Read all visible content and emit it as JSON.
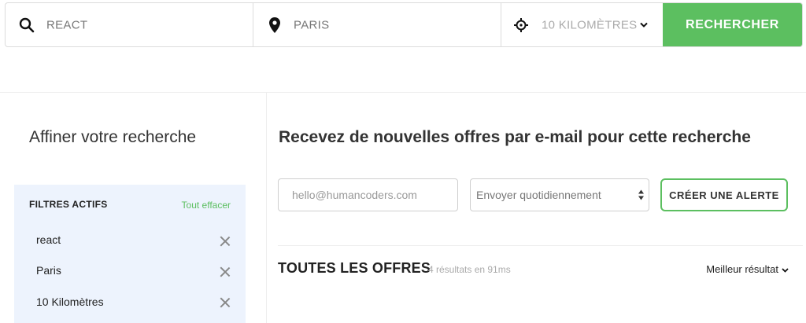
{
  "search": {
    "keyword": "REACT",
    "location": "PARIS",
    "radius": "10 KILOMÈTRES",
    "submit_label": "RECHERCHER",
    "icons": {
      "keyword": "search-icon",
      "location": "map-pin-icon",
      "radius": "crosshair-icon",
      "dropdown": "chevron-down-icon"
    }
  },
  "sidebar": {
    "title": "Affiner votre recherche",
    "filters": {
      "heading": "FILTRES ACTIFS",
      "clear_label": "Tout effacer",
      "items": [
        {
          "label": "react"
        },
        {
          "label": "Paris"
        },
        {
          "label": "10 Kilomètres"
        }
      ]
    }
  },
  "alert": {
    "title": "Recevez de nouvelles offres par e-mail pour cette recherche",
    "email_placeholder": "hello@humancoders.com",
    "frequency_selected": "Envoyer quotidiennement",
    "button_label": "CRÉER UNE ALERTE"
  },
  "results": {
    "title": "TOUTES LES OFFRES",
    "count_text": "4 résultats en 91ms",
    "sort_label": "Meilleur résultat"
  },
  "colors": {
    "accent_green": "#5cbf60",
    "filter_bg": "#edf3fd",
    "border": "#dcdcdc"
  }
}
